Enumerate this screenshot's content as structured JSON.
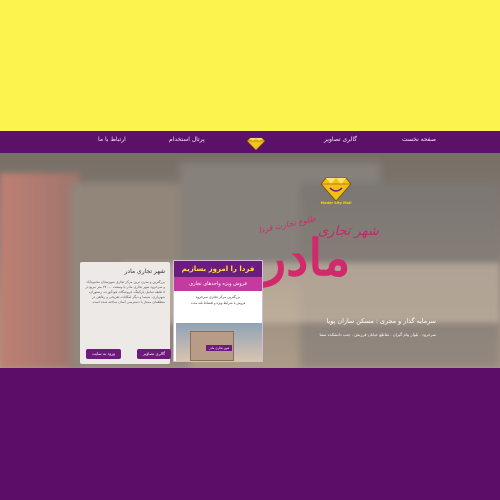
{
  "colors": {
    "top_band": "#fdf34f",
    "nav_bar": "#5b1168",
    "bottom_band": "#5b0e68",
    "accent_pink": "#d12a6c",
    "button_purple": "#6d1a7c"
  },
  "nav": {
    "items": [
      {
        "label": "صفحه نخست"
      },
      {
        "label": "گالری تصاویر"
      },
      {
        "label": "پرتال استخدام"
      },
      {
        "label": "ارتباط با ما"
      }
    ],
    "logo_icon": "diamond-logo-icon"
  },
  "hero": {
    "brand_logo_text": "Mader Sity Mall",
    "tagline": "طلوع تجارت فردا",
    "headline": "مادر",
    "subhead": "شهر تجاری",
    "investor": "سرمایه گذار و مجری : مسکن سازان پویا",
    "address": "سرخرود . بلوار پیام گیران . تقاطع خیابان فرزیش . جنب دانشکده سما"
  },
  "info_card": {
    "title": "شهر تجاری مادر",
    "body": "بزرگترین و مدرن ترین مرکز تجاری شهرستان محمودآباد و سرخرود شهر تجاری مادر با وسعت ۲۷۰۰۰ متر مربع در ۸ طبقه شامل پارکینگ، فروشگاه، فودکورت، رستوران، شهربازی، سینما و دیگر امکانات تفریحی و رفاهی در منطقه‌ای ممتاز با دسترسی آسان ساخته شده است.",
    "gallery_button": "گالری تصاویر",
    "website_button": "ورود به سایت"
  },
  "promo": {
    "headline": "فردا را امروز بسازیم",
    "subtitle": "فروش ویژه واحدهای تجاری",
    "line1": "بزرگترین مرکز تجاری سرخرود",
    "line2": "فروش با شرایط ویژه و اقساط بلند مدت",
    "image_tag": "شهر تجاری مادر"
  }
}
